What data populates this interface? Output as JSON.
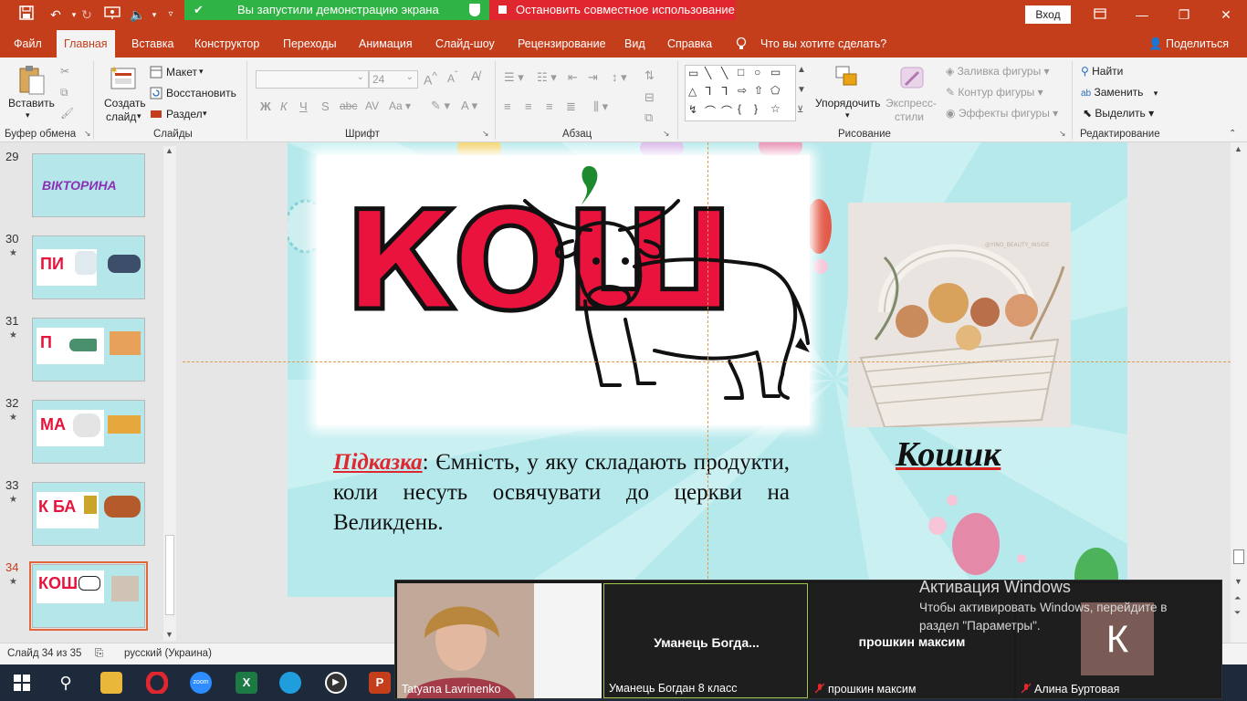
{
  "window": {
    "sharing_banner": "Вы запустили демонстрацию экрана",
    "stop_sharing": "Остановить совместное использование",
    "signin": "Вход"
  },
  "menu": {
    "tabs": [
      "Файл",
      "Главная",
      "Вставка",
      "Конструктор",
      "Переходы",
      "Анимация",
      "Слайд-шоу",
      "Рецензирование",
      "Вид",
      "Справка"
    ],
    "active_tab": "Главная",
    "tell_me": "Что вы хотите сделать?",
    "share": "Поделиться"
  },
  "ribbon": {
    "clipboard": {
      "paste": "Вставить",
      "label": "Буфер обмена"
    },
    "slides": {
      "new_slide_1": "Создать",
      "new_slide_2": "слайд",
      "layout": "Макет",
      "reset": "Восстановить",
      "section": "Раздел",
      "label": "Слайды"
    },
    "font": {
      "size": "24",
      "bold": "Ж",
      "italic": "К",
      "underline": "Ч",
      "strike": "S",
      "label": "Шрифт"
    },
    "paragraph": {
      "label": "Абзац"
    },
    "drawing": {
      "arrange": "Упорядочить",
      "quick_styles_1": "Экспресс-",
      "quick_styles_2": "стили",
      "fill": "Заливка фигуры",
      "outline": "Контур фигуры",
      "effects": "Эффекты фигуры",
      "label": "Рисование"
    },
    "editing": {
      "find": "Найти",
      "replace": "Заменить",
      "select": "Выделить",
      "label": "Редактирование"
    }
  },
  "thumbnails": [
    {
      "num": "29",
      "star": "",
      "text": "ВІКТОРИНА"
    },
    {
      "num": "30",
      "star": "★",
      "text": "ПИ"
    },
    {
      "num": "31",
      "star": "★",
      "text": "П"
    },
    {
      "num": "32",
      "star": "★",
      "text": "МА"
    },
    {
      "num": "33",
      "star": "★",
      "text": "К БА"
    },
    {
      "num": "34",
      "star": "★",
      "text": "КОШ"
    }
  ],
  "slide": {
    "word": "КОШ",
    "apostrophe": "’",
    "hint_label": "Підказка",
    "hint_text": ": Ємність, у яку складають продукти, коли несуть освячувати до церкви на Великдень.",
    "answer": "Кошик",
    "photo_watermark": "@YINO_BEAUTY_INSIDE"
  },
  "status": {
    "slide_counter": "Слайд 34 из 35",
    "language": "русский (Украина)"
  },
  "zoom": {
    "tiles": [
      {
        "label": "Tatyana Lavrinenko",
        "center": "",
        "muted": false
      },
      {
        "label": "Уманець Богдан 8 класс",
        "center": "Уманець  Богда...",
        "muted": false
      },
      {
        "label": "прошкин максим",
        "center": "прошкин максим",
        "muted": true
      },
      {
        "label": "Алина Буртовая",
        "center": "",
        "muted": true
      }
    ],
    "avatar_letter": "К"
  },
  "activation": {
    "title": "Активация Windows",
    "line1": "Чтобы активировать Windows, перейдите в",
    "line2": "раздел \"Параметры\"."
  },
  "taskbar": {
    "apps": [
      "windows-start",
      "search",
      "file-explorer",
      "opera",
      "zoom",
      "excel",
      "edge",
      "media-player",
      "powerpoint"
    ]
  },
  "colors": {
    "ppt_accent": "#c43e1c",
    "share_green": "#2fb344",
    "stop_red": "#e0262e",
    "title_red": "#e9133d",
    "slide_bg": "#b6e9ec"
  }
}
